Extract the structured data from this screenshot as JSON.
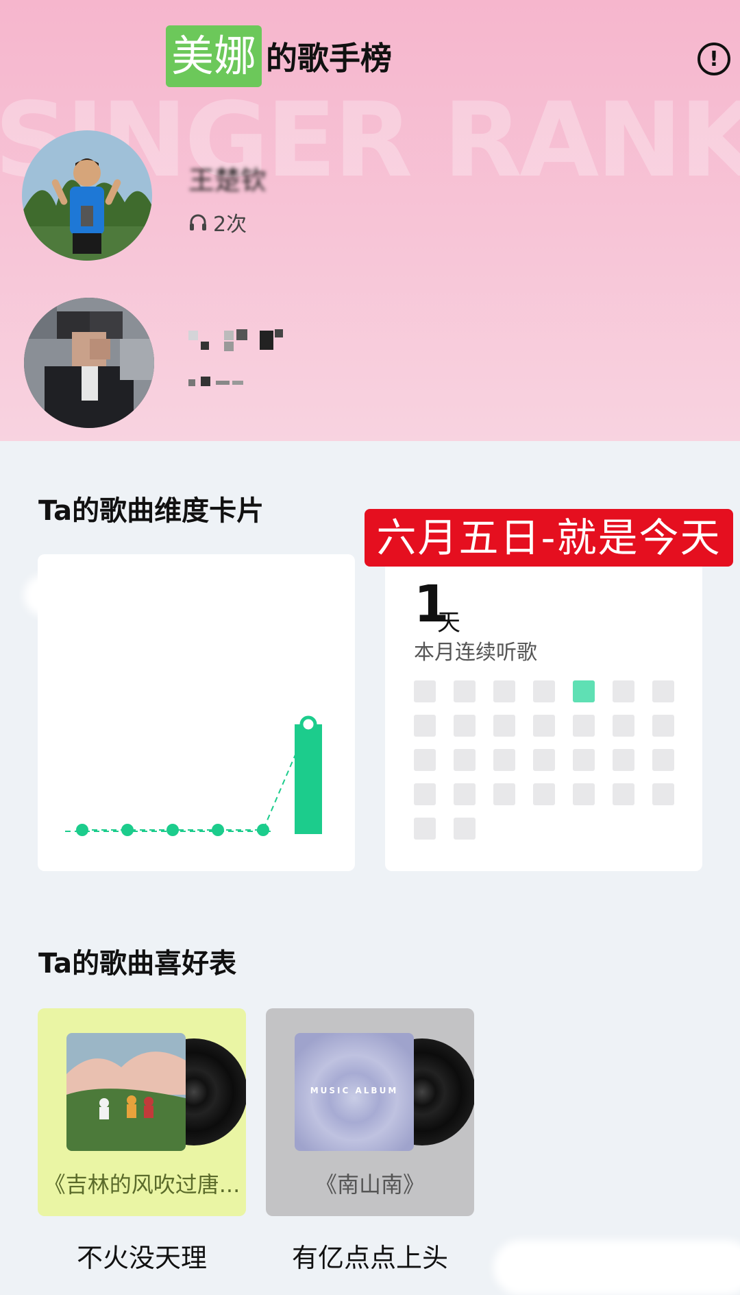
{
  "header": {
    "name_highlight": "美娜",
    "title_suffix": "的歌手榜",
    "watermark": "SINGER RANK",
    "info_icon": "info-circle-icon"
  },
  "singers": [
    {
      "name": "王楚钦",
      "plays": "2次",
      "icon": "headphones-icon"
    },
    {
      "name": "",
      "plays": "2次",
      "icon": "headphones-icon"
    }
  ],
  "dimension_section": {
    "title": "Ta的歌曲维度卡片",
    "banner": "六月五日-就是今天",
    "streak_value": "1",
    "streak_unit": "天",
    "streak_label": "本月连续听歌",
    "calendar_cells": 30,
    "active_cell_index": 4,
    "accent_color": "#1ccc8c"
  },
  "chart_data": {
    "type": "line",
    "values": [
      0,
      0,
      0,
      0,
      0,
      1
    ],
    "last_point_style": "bar",
    "color": "#1ccc8c"
  },
  "preference_section": {
    "title": "Ta的歌曲喜好表",
    "albums": [
      {
        "title": "《吉林的风吹过唐...",
        "caption": "不火没天理",
        "bg": "#eaf5a4"
      },
      {
        "title": "《南山南》",
        "caption": "有亿点点上头",
        "bg": "#c3c3c5",
        "cover_text": "MUSIC ALBUM"
      }
    ]
  }
}
